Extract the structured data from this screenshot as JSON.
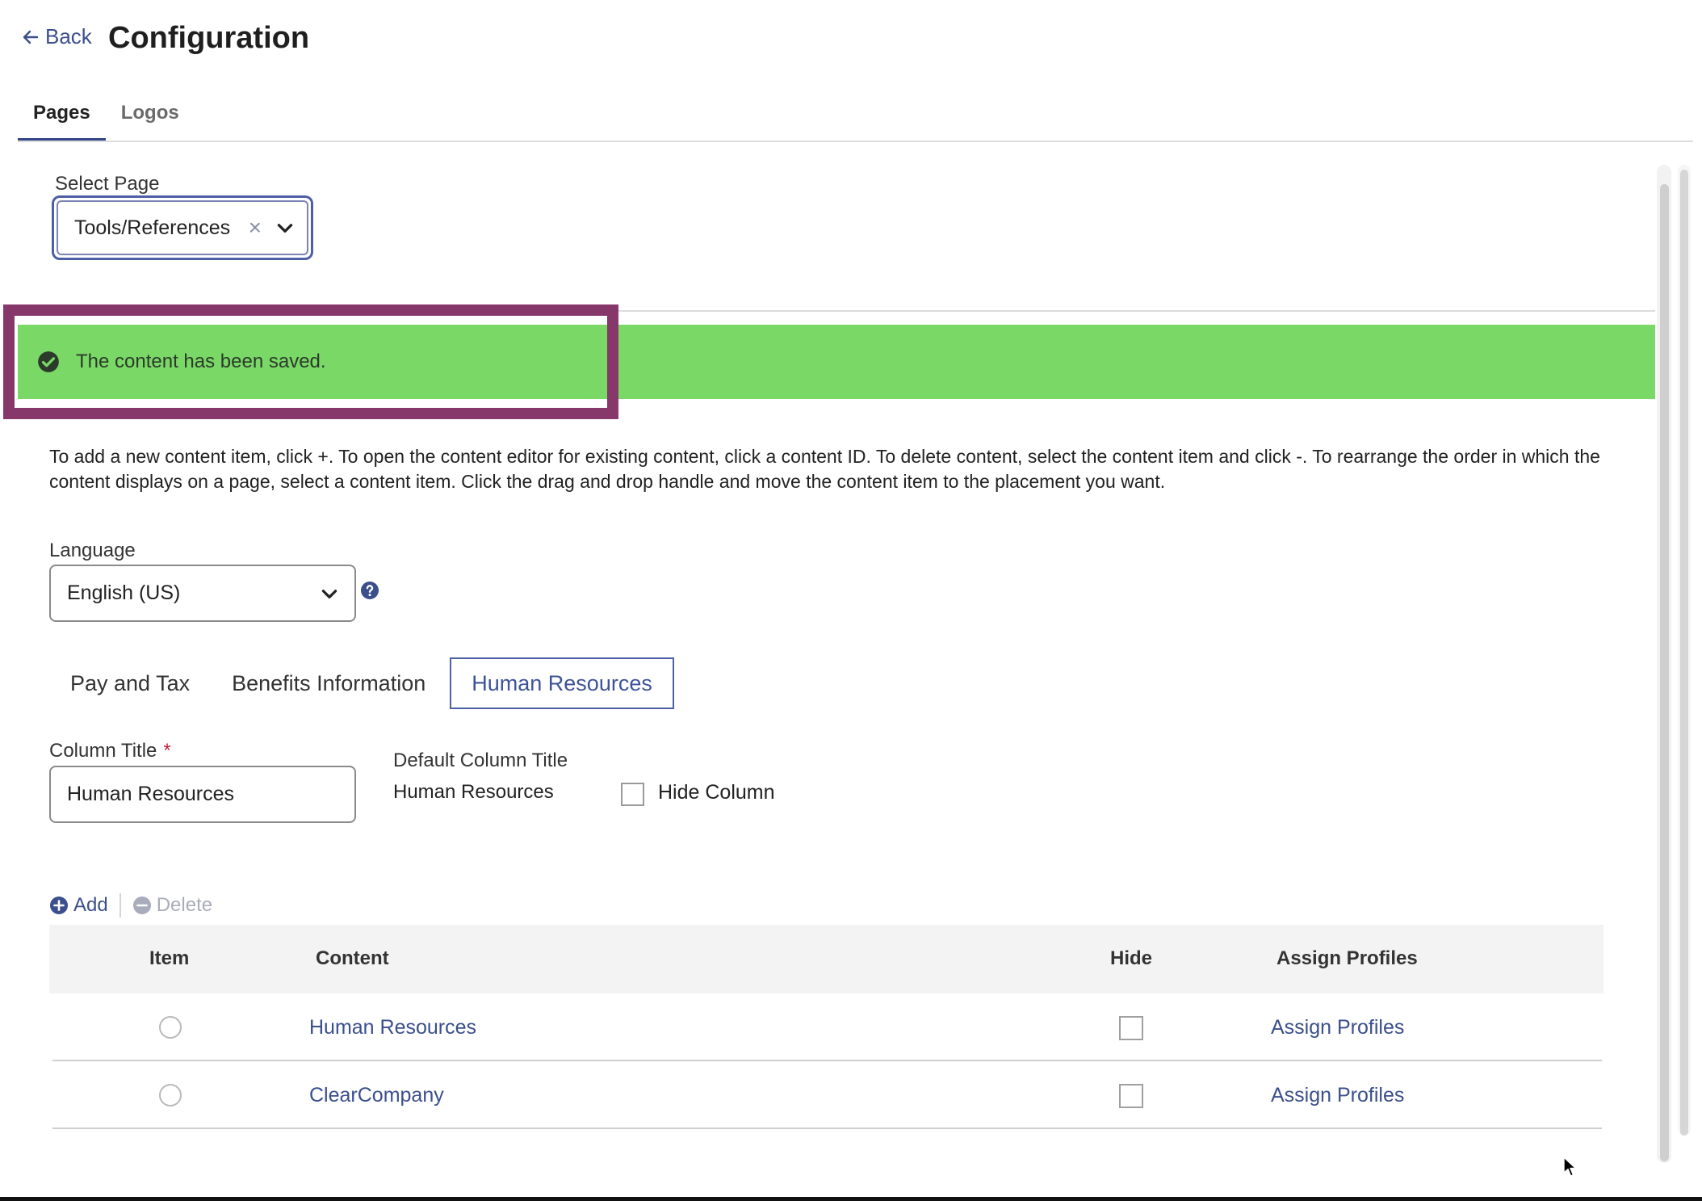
{
  "header": {
    "back_label": "Back",
    "title": "Configuration"
  },
  "top_tabs": [
    {
      "label": "Pages",
      "active": true
    },
    {
      "label": "Logos",
      "active": false
    }
  ],
  "select_page": {
    "label": "Select Page",
    "value": "Tools/References"
  },
  "banner": {
    "message": "The content has been saved.",
    "color": "#7ad866",
    "highlight_color": "#86386a"
  },
  "instructions": "To add a new content item, click +. To open the content editor for existing content, click a content ID. To delete content, select the content item and click -. To rearrange the order in which the content displays on a page, select a content item. Click the drag and drop handle and move the content item to the placement you want.",
  "language": {
    "label": "Language",
    "value": "English (US)",
    "help_icon": "question-circle-icon"
  },
  "column_tabs": [
    {
      "label": "Pay and Tax",
      "active": false
    },
    {
      "label": "Benefits Information",
      "active": false
    },
    {
      "label": "Human Resources",
      "active": true
    }
  ],
  "column_title": {
    "label": "Column Title",
    "required_mark": "*",
    "value": "Human Resources"
  },
  "default_column_title": {
    "label": "Default Column Title",
    "value": "Human Resources"
  },
  "hide_column": {
    "label": "Hide Column",
    "checked": false
  },
  "toolbar": {
    "add_label": "Add",
    "delete_label": "Delete"
  },
  "table": {
    "headers": {
      "item": "Item",
      "content": "Content",
      "hide": "Hide",
      "assign": "Assign Profiles"
    },
    "rows": [
      {
        "content": "Human Resources",
        "hide": false,
        "assign": "Assign Profiles"
      },
      {
        "content": "ClearCompany",
        "hide": false,
        "assign": "Assign Profiles"
      }
    ]
  },
  "colors": {
    "accent": "#3a4f8c",
    "tab_underline": "#34468a"
  }
}
